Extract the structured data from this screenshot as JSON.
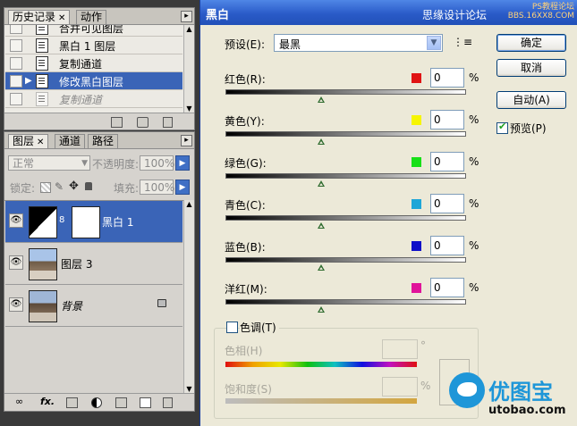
{
  "history_panel": {
    "tabs": [
      "历史记录",
      "动作"
    ],
    "items": [
      {
        "label": "合并可见图层",
        "state": "normal"
      },
      {
        "label": "黑白 1 图层",
        "state": "normal"
      },
      {
        "label": "复制通道",
        "state": "normal"
      },
      {
        "label": "修改黑白图层",
        "state": "selected"
      },
      {
        "label": "复制通道",
        "state": "dimmed"
      }
    ]
  },
  "layers_panel": {
    "tabs": [
      "图层",
      "通道",
      "路径"
    ],
    "blend_mode": "正常",
    "opacity_label": "不透明度:",
    "opacity_value": "100%",
    "lock_label": "锁定:",
    "fill_label": "填充:",
    "fill_value": "100%",
    "layers": [
      {
        "name": "黑白 1",
        "selected": true
      },
      {
        "name": "图层 3",
        "selected": false
      },
      {
        "name": "背景",
        "selected": false
      }
    ]
  },
  "dialog": {
    "title": "黑白",
    "watermark_top": "思缘设计论坛",
    "watermark_url": "PS教程论坛 BBS.16XX8.COM",
    "preset_label": "预设(E):",
    "preset_value": "最黑",
    "channels": [
      {
        "label": "红色(R):",
        "value": "0",
        "color": "#e01414",
        "level": 0.4
      },
      {
        "label": "黄色(Y):",
        "value": "0",
        "color": "#f6f500",
        "level": 0.4
      },
      {
        "label": "绿色(G):",
        "value": "0",
        "color": "#18e018",
        "level": 0.4
      },
      {
        "label": "青色(C):",
        "value": "0",
        "color": "#1ea6d8",
        "level": 0.4
      },
      {
        "label": "蓝色(B):",
        "value": "0",
        "color": "#1010c8",
        "level": 0.4
      },
      {
        "label": "洋红(M):",
        "value": "0",
        "color": "#e0149a",
        "level": 0.4
      }
    ],
    "percent": "%",
    "buttons": {
      "ok": "确定",
      "cancel": "取消",
      "auto": "自动(A)"
    },
    "preview_label": "预览(P)",
    "preview_checked": true,
    "tint_label": "色调(T)",
    "tint_checked": false,
    "hue_label": "色相(H)",
    "hue_unit": "°",
    "saturation_label": "饱和度(S)",
    "saturation_unit": "%"
  },
  "brand": {
    "name": "优图宝",
    "url": "utobao.com"
  }
}
